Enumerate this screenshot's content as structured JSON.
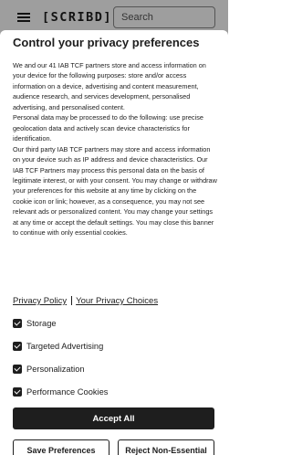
{
  "header": {
    "logo_text": "[SCRIBD]",
    "search_placeholder": "Search"
  },
  "consent": {
    "title": "Control your privacy preferences",
    "paragraphs": [
      "We and our 41 IAB TCF partners store and access information on your device for the following purposes: store and/or access information on a device, advertising and content measurement, audience research, and services development, personalised advertising, and personalised content.",
      "Personal data may be processed to do the following: use precise geolocation data and actively scan device characteristics for identification.",
      "Our third party IAB TCF partners may store and access information on your device such as IP address and device characteristics. Our IAB TCF Partners may process this personal data on the basis of legitimate interest, or with your consent. You may change or withdraw your preferences for this website at any time by clicking on the cookie icon or link; however, as a consequence, you may not see relevant ads or personalized content. You may change your settings at any time or accept the default settings. You may close this banner to continue with only essential cookies."
    ],
    "links": {
      "privacy_policy": "Privacy Policy",
      "privacy_choices": "Your Privacy Choices"
    },
    "options": [
      {
        "label": "Storage",
        "checked": true
      },
      {
        "label": "Targeted Advertising",
        "checked": true
      },
      {
        "label": "Personalization",
        "checked": true
      },
      {
        "label": "Performance Cookies",
        "checked": true
      }
    ],
    "buttons": {
      "accept_all": "Accept All",
      "save_preferences": "Save Preferences",
      "reject_non_essential": "Reject Non-Essential"
    }
  },
  "colors": {
    "primary": "#1e1e1e",
    "background": "#ffffff",
    "overlay": "rgba(0,0,0,0.38)"
  }
}
